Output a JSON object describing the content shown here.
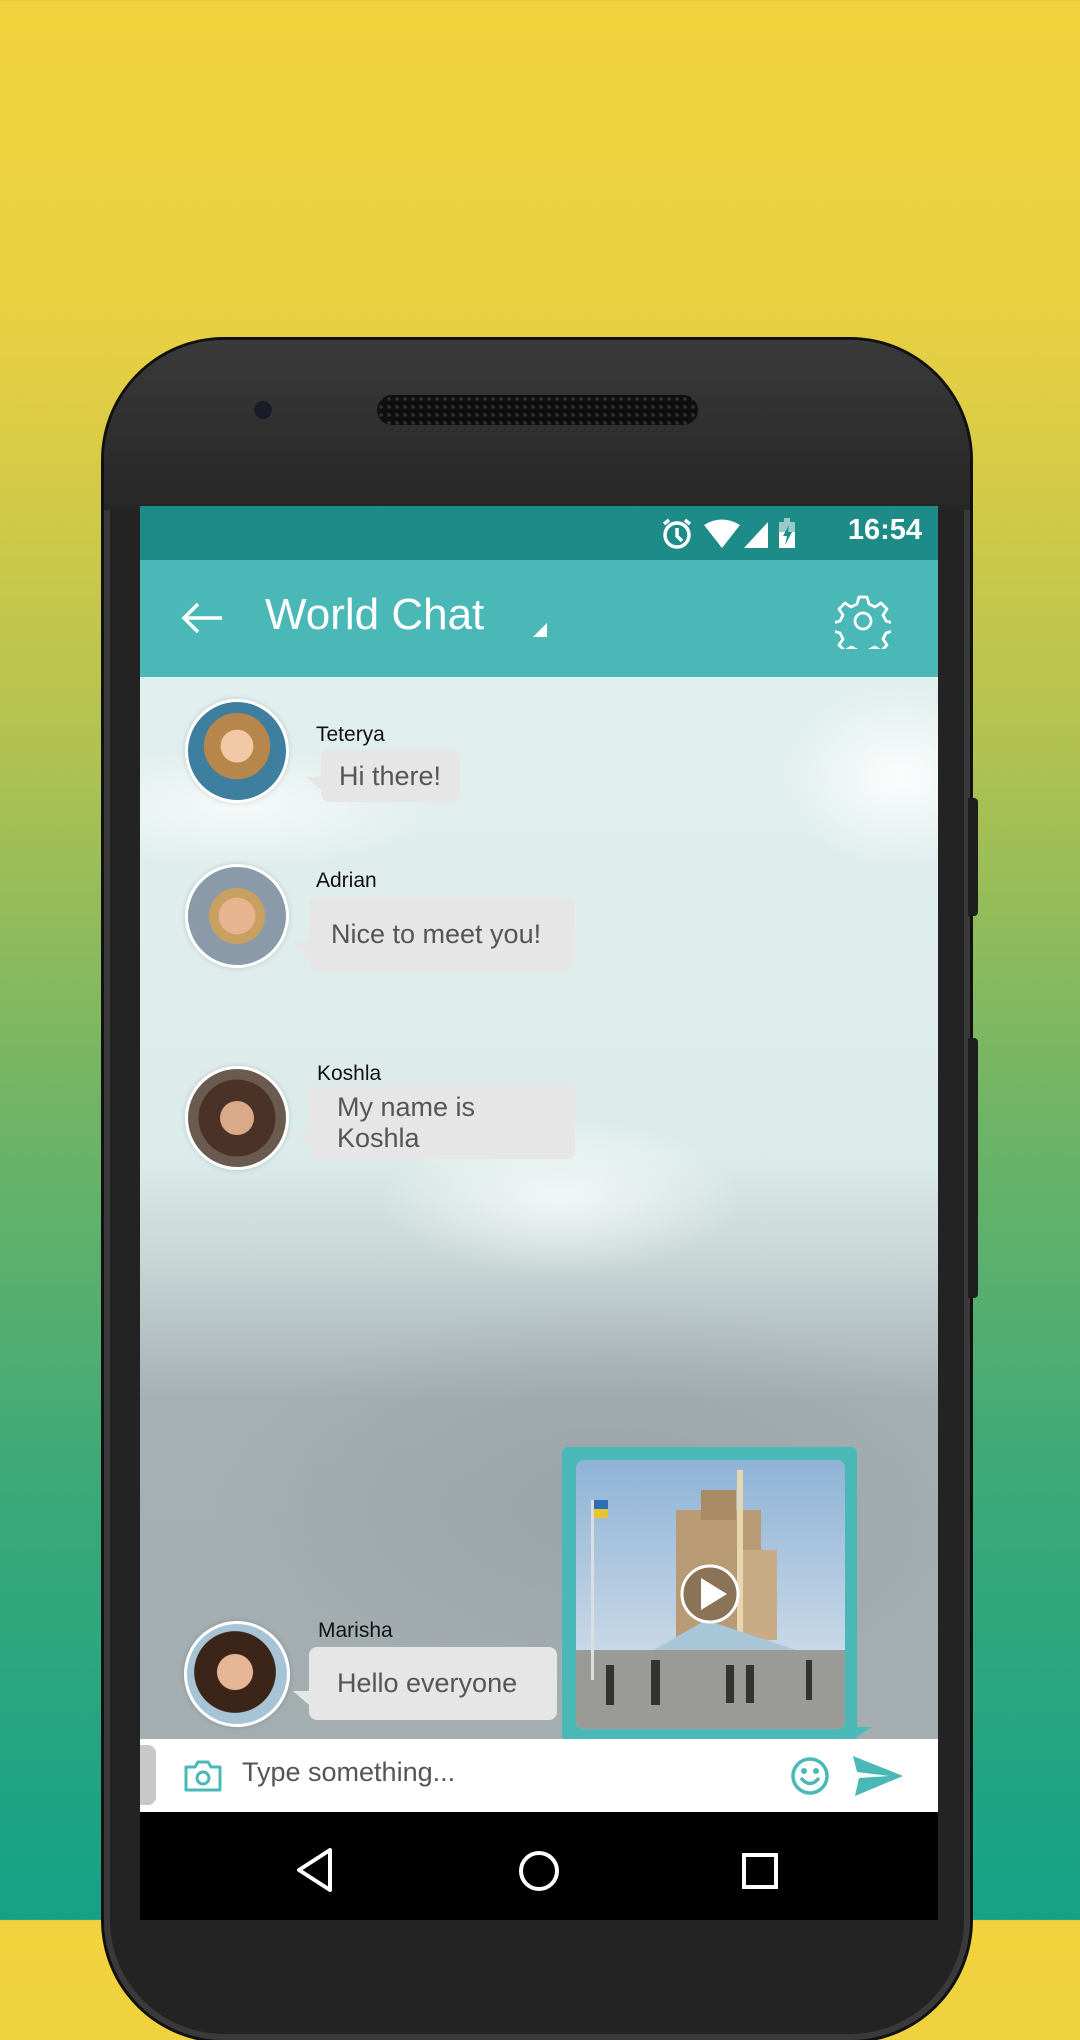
{
  "status_bar": {
    "time": "16:54",
    "icons": [
      "alarm-icon",
      "wifi-icon",
      "signal-icon",
      "battery-charging-icon"
    ]
  },
  "app_bar": {
    "title": "World Chat",
    "back_icon": "arrow-left-icon",
    "dropdown_icon": "triangle-down-icon",
    "settings_icon": "gear-icon"
  },
  "messages": [
    {
      "sender": "Teterya",
      "text": "Hi there!"
    },
    {
      "sender": "Adrian",
      "text": "Nice to meet you!"
    },
    {
      "sender": "Koshla",
      "text": "My name is Koshla"
    },
    {
      "sender": "Marisha",
      "text": "Hello everyone"
    }
  ],
  "outgoing_media": {
    "type": "video",
    "icon": "play-icon"
  },
  "input_bar": {
    "placeholder": "Type something...",
    "value": "",
    "camera_icon": "camera-icon",
    "emoji_icon": "smiley-icon",
    "send_icon": "send-icon"
  },
  "nav_bar": {
    "icons": [
      "back-icon",
      "home-icon",
      "recents-icon"
    ]
  },
  "colors": {
    "accent": "#4bb8b8",
    "status_bar": "#1d8b87",
    "bubble": "#e6e6e6"
  }
}
